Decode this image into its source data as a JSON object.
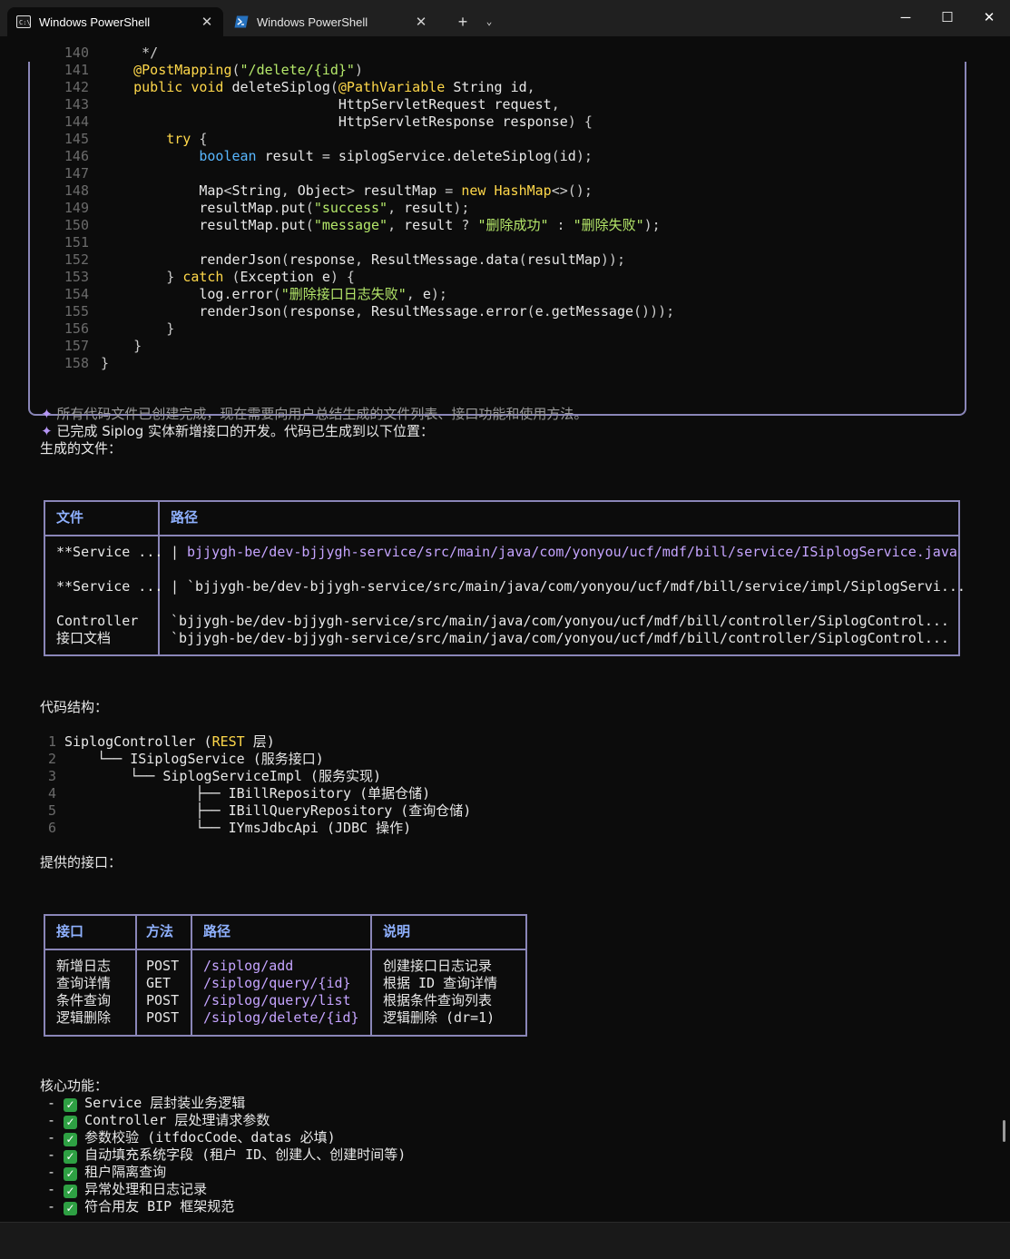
{
  "window": {
    "tabs": [
      {
        "label": "Windows PowerShell",
        "close": "✕"
      },
      {
        "label": "Windows PowerShell",
        "close": "✕"
      }
    ],
    "new_tab": "+",
    "dropdown": "⌄",
    "minimize": "─",
    "maximize": "☐",
    "close": "✕"
  },
  "code": {
    "lines": [
      {
        "n": "140",
        "text": "     */"
      },
      {
        "n": "141",
        "text": "    @PostMapping(\"/delete/{id}\")"
      },
      {
        "n": "142",
        "text": "    public void deleteSiplog(@PathVariable String id,"
      },
      {
        "n": "143",
        "text": "                             HttpServletRequest request,"
      },
      {
        "n": "144",
        "text": "                             HttpServletResponse response) {"
      },
      {
        "n": "145",
        "text": "        try {"
      },
      {
        "n": "146",
        "text": "            boolean result = siplogService.deleteSiplog(id);"
      },
      {
        "n": "147",
        "text": ""
      },
      {
        "n": "148",
        "text": "            Map<String, Object> resultMap = new HashMap<>();"
      },
      {
        "n": "149",
        "text": "            resultMap.put(\"success\", result);"
      },
      {
        "n": "150",
        "text": "            resultMap.put(\"message\", result ? \"删除成功\" : \"删除失败\");"
      },
      {
        "n": "151",
        "text": ""
      },
      {
        "n": "152",
        "text": "            renderJson(response, ResultMessage.data(resultMap));"
      },
      {
        "n": "153",
        "text": "        } catch (Exception e) {"
      },
      {
        "n": "154",
        "text": "            log.error(\"删除接口日志失败\", e);"
      },
      {
        "n": "155",
        "text": "            renderJson(response, ResultMessage.error(e.getMessage()));"
      },
      {
        "n": "156",
        "text": "        }"
      },
      {
        "n": "157",
        "text": "    }"
      },
      {
        "n": "158",
        "text": "}"
      }
    ]
  },
  "messages": {
    "thinking": "✦ 所有代码文件已创建完成，现在需要向用户总结生成的文件列表、接口功能和使用方法。",
    "done": "✦ 已完成 Siplog 实体新增接口的开发。代码已生成到以下位置："
  },
  "files_section": {
    "heading": "生成的文件：",
    "headers": [
      "文件",
      "路径"
    ],
    "rows": [
      {
        "file": "**Service ...",
        "sep": "|",
        "path": "bjjygh-be/dev-bjjygh-service/src/main/java/com/yonyou/ucf/mdf/bill/service/ISiplogService.java"
      },
      {
        "file": "**Service ...",
        "sep": "|",
        "path": "`bjjygh-be/dev-bjjygh-service/src/main/java/com/yonyou/ucf/mdf/bill/service/impl/SiplogServi..."
      },
      {
        "file": "Controller",
        "file2": "接口文档",
        "path": "`bjjygh-be/dev-bjjygh-service/src/main/java/com/yonyou/ucf/mdf/bill/controller/SiplogControl...",
        "path2": "`bjjygh-be/dev-bjjygh-service/src/main/java/com/yonyou/ucf/mdf/bill/controller/SiplogControl..."
      }
    ]
  },
  "structure_section": {
    "heading": "代码结构：",
    "lines": [
      {
        "n": "1",
        "text": "SiplogController (REST 层)"
      },
      {
        "n": "2",
        "text": "    └── ISiplogService (服务接口)"
      },
      {
        "n": "3",
        "text": "        └── SiplogServiceImpl (服务实现)"
      },
      {
        "n": "4",
        "text": "                ├── IBillRepository (单据仓储)"
      },
      {
        "n": "5",
        "text": "                ├── IBillQueryRepository (查询仓储)"
      },
      {
        "n": "6",
        "text": "                └── IYmsJdbcApi (JDBC 操作)"
      }
    ]
  },
  "api_section": {
    "heading": "提供的接口：",
    "headers": [
      "接口",
      "方法",
      "路径",
      "说明"
    ],
    "rows": [
      {
        "name": "新增日志",
        "method": "POST",
        "path": "/siplog/add",
        "desc": "创建接口日志记录"
      },
      {
        "name": "查询详情",
        "method": "GET",
        "path": "/siplog/query/{id}",
        "desc": "根据 ID 查询详情"
      },
      {
        "name": "条件查询",
        "method": "POST",
        "path": "/siplog/query/list",
        "desc": "根据条件查询列表"
      },
      {
        "name": "逻辑删除",
        "method": "POST",
        "path": "/siplog/delete/{id}",
        "desc": "逻辑删除 (dr=1)"
      }
    ]
  },
  "features_section": {
    "heading": "核心功能：",
    "bullet": "-",
    "items": [
      "Service 层封装业务逻辑",
      "Controller 层处理请求参数",
      "参数校验 (itfdocCode、datas 必填)",
      "自动填充系统字段 (租户 ID、创建人、创建时间等)",
      "租户隔离查询",
      "异常处理和日志记录",
      "符合用友 BIP 框架规范"
    ]
  },
  "colors": {
    "keyword": "#ffd84a",
    "type": "#58b7ff",
    "string": "#b5e86a",
    "accent": "#8a86b8",
    "check": "#2ea043"
  }
}
